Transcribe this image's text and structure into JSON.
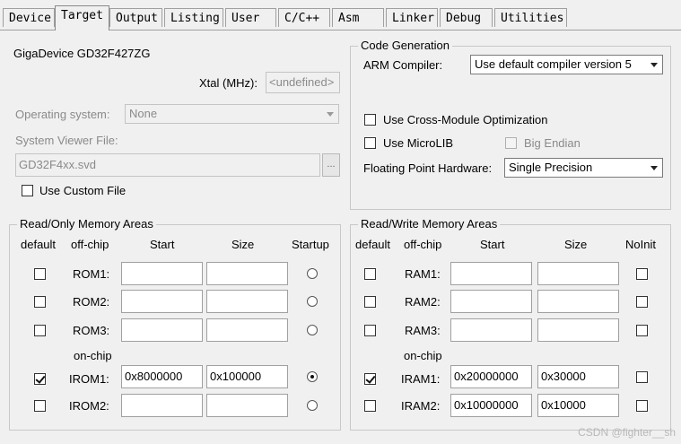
{
  "tabs": [
    "Device",
    "Target",
    "Output",
    "Listing",
    "User",
    "C/C++",
    "Asm",
    "Linker",
    "Debug",
    "Utilities"
  ],
  "device": {
    "name": "GigaDevice GD32F427ZG",
    "xtal_label": "Xtal (MHz):",
    "xtal_value": "<undefined>",
    "os_label": "Operating system:",
    "os_value": "None",
    "svd_label": "System Viewer File:",
    "svd_value": "GD32F4xx.svd",
    "browse_label": "...",
    "custom_file_label": "Use Custom File"
  },
  "codegen": {
    "title": "Code Generation",
    "compiler_label": "ARM Compiler:",
    "compiler_value": "Use default compiler version 5",
    "cross_module_label": "Use Cross-Module Optimization",
    "microlib_label": "Use MicroLIB",
    "big_endian_label": "Big Endian",
    "fpu_label": "Floating Point Hardware:",
    "fpu_value": "Single Precision"
  },
  "rom": {
    "title": "Read/Only Memory Areas",
    "headers": {
      "default": "default",
      "offchip": "off-chip",
      "start": "Start",
      "size": "Size",
      "startup": "Startup"
    },
    "onchip_label": "on-chip",
    "rows": [
      {
        "label": "ROM1:",
        "start": "",
        "size": "",
        "default": false,
        "startup": false
      },
      {
        "label": "ROM2:",
        "start": "",
        "size": "",
        "default": false,
        "startup": false
      },
      {
        "label": "ROM3:",
        "start": "",
        "size": "",
        "default": false,
        "startup": false
      },
      {
        "label": "IROM1:",
        "start": "0x8000000",
        "size": "0x100000",
        "default": true,
        "startup": true
      },
      {
        "label": "IROM2:",
        "start": "",
        "size": "",
        "default": false,
        "startup": false
      }
    ]
  },
  "ram": {
    "title": "Read/Write Memory Areas",
    "headers": {
      "default": "default",
      "offchip": "off-chip",
      "start": "Start",
      "size": "Size",
      "noinit": "NoInit"
    },
    "onchip_label": "on-chip",
    "rows": [
      {
        "label": "RAM1:",
        "start": "",
        "size": "",
        "default": false,
        "noinit": false
      },
      {
        "label": "RAM2:",
        "start": "",
        "size": "",
        "default": false,
        "noinit": false
      },
      {
        "label": "RAM3:",
        "start": "",
        "size": "",
        "default": false,
        "noinit": false
      },
      {
        "label": "IRAM1:",
        "start": "0x20000000",
        "size": "0x30000",
        "default": true,
        "noinit": false
      },
      {
        "label": "IRAM2:",
        "start": "0x10000000",
        "size": "0x10000",
        "default": false,
        "noinit": false
      }
    ]
  },
  "watermark": "CSDN @fighter__sh"
}
